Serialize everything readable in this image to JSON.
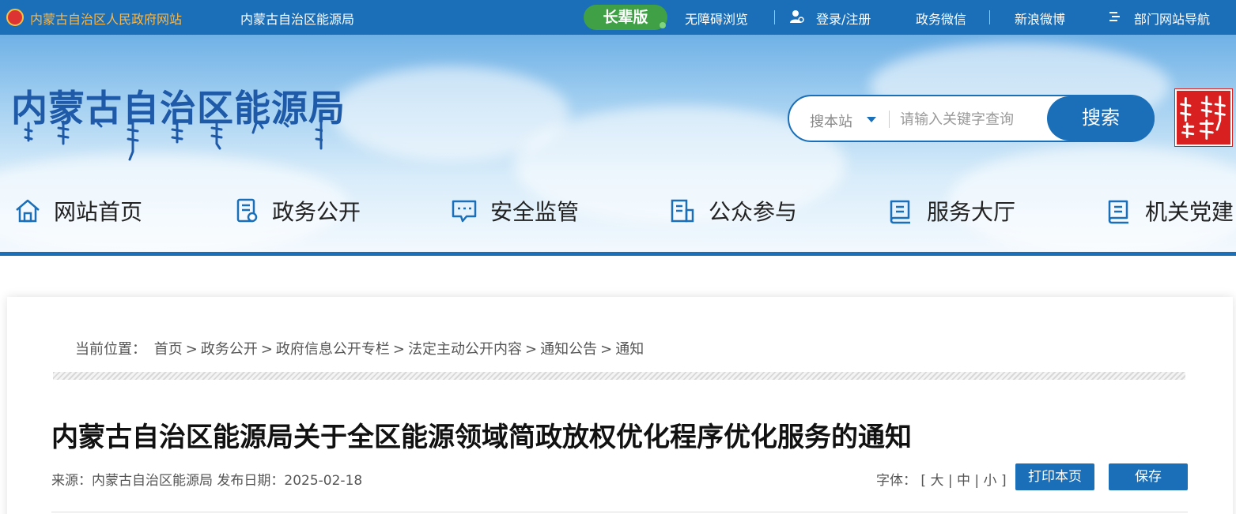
{
  "topbar": {
    "gov_link": "内蒙古自治区人民政府网站",
    "site_link": "内蒙古自治区能源局",
    "elder_mode": "长辈版",
    "accessibility": "无障碍浏览",
    "login": "登录/注册",
    "wechat": "政务微信",
    "weibo": "新浪微博",
    "dept_nav": "部门网站导航"
  },
  "header": {
    "site_title": "内蒙古自治区能源局",
    "search": {
      "scope": "搜本站",
      "placeholder": "请输入关键字查询",
      "button": "搜索"
    }
  },
  "nav": {
    "items": [
      {
        "label": "网站首页",
        "icon": "home-icon"
      },
      {
        "label": "政务公开",
        "icon": "document-icon"
      },
      {
        "label": "安全监管",
        "icon": "chat-icon"
      },
      {
        "label": "公众参与",
        "icon": "building-icon"
      },
      {
        "label": "服务大厅",
        "icon": "book-icon"
      },
      {
        "label": "机关党建",
        "icon": "book-icon"
      }
    ]
  },
  "breadcrumb": {
    "label": "当前位置：",
    "items": [
      "首页",
      "政务公开",
      "政府信息公开专栏",
      "法定主动公开内容",
      "通知公告",
      "通知"
    ],
    "separator": ">"
  },
  "article": {
    "title": "内蒙古自治区能源局关于全区能源领域简政放权优化程序优化服务的通知",
    "source_label": "来源：",
    "source": "内蒙古自治区能源局",
    "date_label": "发布日期：",
    "date": "2025-02-18",
    "font_label": "字体：",
    "font_open": "[",
    "font_large": "大",
    "font_medium": "中",
    "font_small": "小",
    "font_close": "]",
    "font_sep": "|",
    "print_button": "打印本页",
    "save_button": "保存"
  },
  "colors": {
    "primary": "#1a6fb8",
    "elder_green": "#3fa046",
    "gov_link_orange": "#f7b84e",
    "seal_red": "#d82020"
  }
}
